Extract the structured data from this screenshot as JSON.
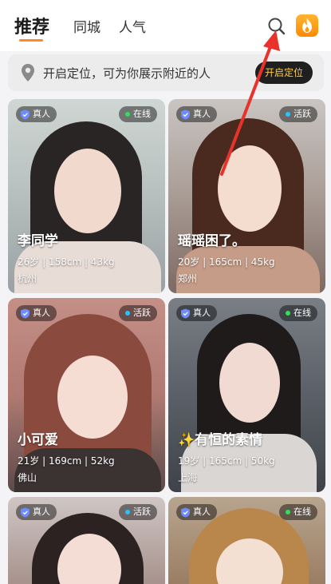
{
  "header": {
    "tabs": [
      {
        "label": "推荐",
        "active": true
      },
      {
        "label": "同城",
        "active": false
      },
      {
        "label": "人气",
        "active": false
      }
    ],
    "search_icon": "search-icon",
    "hot_icon": "flame-icon",
    "accent_color": "#ff8a1f"
  },
  "location_bar": {
    "text": "开启定位，可为你展示附近的人",
    "button_label": "开启定位",
    "icon": "location-pin-icon"
  },
  "cards": [
    {
      "verified": "真人",
      "status": "在线",
      "status_color": "#2ee05a",
      "name": "李同学",
      "stats": "26岁 | 158cm | 43kg",
      "city": "杭州"
    },
    {
      "verified": "真人",
      "status": "活跃",
      "status_color": "#27c3ff",
      "name": "瑶瑶困了。",
      "stats": "20岁 | 165cm | 45kg",
      "city": "郑州"
    },
    {
      "verified": "真人",
      "status": "活跃",
      "status_color": "#27c3ff",
      "name": "小可爱",
      "stats": "21岁 | 169cm | 52kg",
      "city": "佛山"
    },
    {
      "verified": "真人",
      "status": "在线",
      "status_color": "#2ee05a",
      "name": "✨有恒的素情",
      "stats": "19岁 | 165cm | 50kg",
      "city": "上海"
    },
    {
      "verified": "真人",
      "status": "活跃",
      "status_color": "#27c3ff",
      "name": "",
      "stats": "",
      "city": ""
    },
    {
      "verified": "真人",
      "status": "在线",
      "status_color": "#2ee05a",
      "name": "",
      "stats": "",
      "city": ""
    }
  ]
}
